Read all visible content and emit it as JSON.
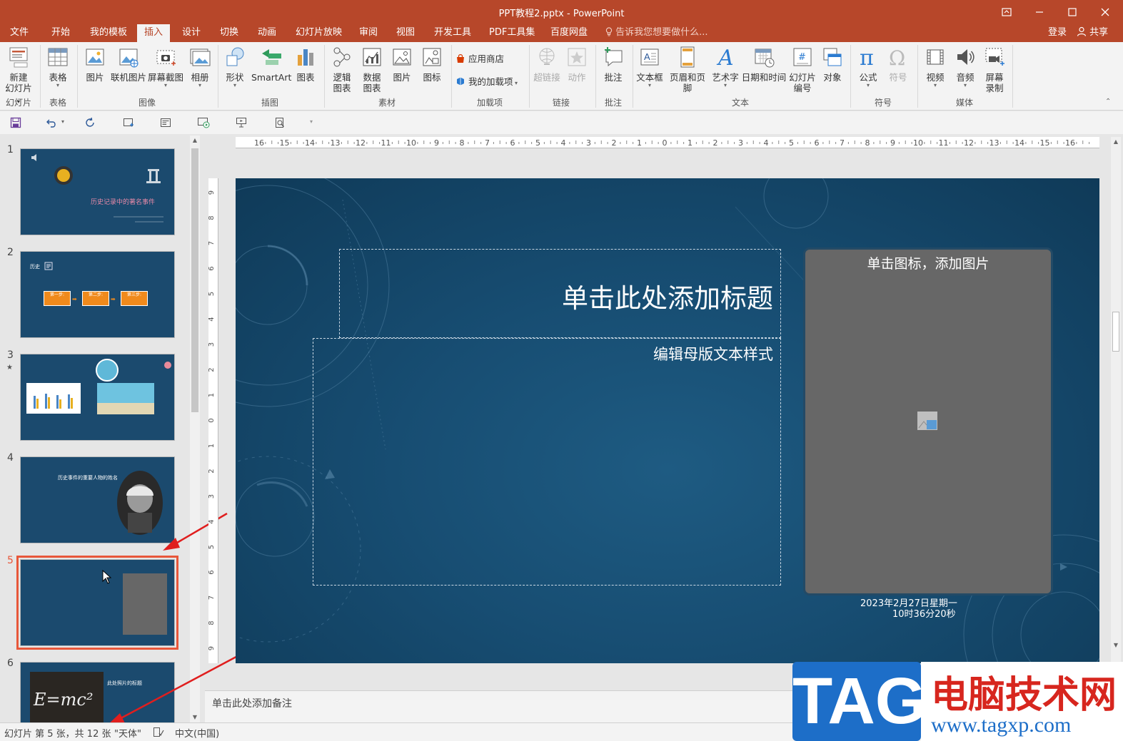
{
  "window": {
    "title": "PPT教程2.pptx - PowerPoint",
    "controls": [
      "restore-ribbon",
      "minimize",
      "maximize",
      "close"
    ]
  },
  "tabs": [
    {
      "label": "文件",
      "active": false
    },
    {
      "label": "开始",
      "active": false
    },
    {
      "label": "我的模板",
      "active": false
    },
    {
      "label": "插入",
      "active": true
    },
    {
      "label": "设计",
      "active": false
    },
    {
      "label": "切换",
      "active": false
    },
    {
      "label": "动画",
      "active": false
    },
    {
      "label": "幻灯片放映",
      "active": false
    },
    {
      "label": "审阅",
      "active": false
    },
    {
      "label": "视图",
      "active": false
    },
    {
      "label": "开发工具",
      "active": false
    },
    {
      "label": "PDF工具集",
      "active": false
    },
    {
      "label": "百度网盘",
      "active": false
    }
  ],
  "tell_me": "告诉我您想要做什么...",
  "account": {
    "login": "登录",
    "share": "共享"
  },
  "ribbon": {
    "groups": [
      {
        "label": "幻灯片"
      },
      {
        "label": "表格"
      },
      {
        "label": "图像"
      },
      {
        "label": "插图"
      },
      {
        "label": "素材"
      },
      {
        "label": "加载项"
      },
      {
        "label": "链接"
      },
      {
        "label": "批注"
      },
      {
        "label": "文本"
      },
      {
        "label": "符号"
      },
      {
        "label": "媒体"
      }
    ],
    "buttons": {
      "new_slide": {
        "line1": "新建",
        "line2": "幻灯片"
      },
      "table": "表格",
      "picture": "图片",
      "online_picture": "联机图片",
      "screenshot": "屏幕截图",
      "album": "相册",
      "shapes": "形状",
      "smartart": "SmartArt",
      "chart": "图表",
      "logic_chart": {
        "line1": "逻辑",
        "line2": "图表"
      },
      "data_chart": {
        "line1": "数据",
        "line2": "图表"
      },
      "material_picture": "图片",
      "icon": "图标",
      "store": "应用商店",
      "my_addins": "我的加载项",
      "hyperlink": "超链接",
      "action": "动作",
      "comment": "批注",
      "textbox": "文本框",
      "header_footer": "页眉和页脚",
      "wordart": "艺术字",
      "datetime": "日期和时间",
      "slide_number": {
        "line1": "幻灯片",
        "line2": "编号"
      },
      "object": "对象",
      "equation": "公式",
      "symbol": "符号",
      "video": "视频",
      "audio": "音频",
      "screen_record": {
        "line1": "屏幕",
        "line2": "录制"
      }
    }
  },
  "ruler": {
    "h_labels": [
      "16",
      "15",
      "14",
      "13",
      "12",
      "11",
      "10",
      "9",
      "8",
      "7",
      "6",
      "5",
      "4",
      "3",
      "2",
      "1",
      "0",
      "1",
      "2",
      "3",
      "4",
      "5",
      "6",
      "7",
      "8",
      "9",
      "10",
      "11",
      "12",
      "13",
      "14",
      "15",
      "16"
    ],
    "v_labels": [
      "9",
      "8",
      "7",
      "6",
      "5",
      "4",
      "3",
      "2",
      "1",
      "0",
      "1",
      "2",
      "3",
      "4",
      "5",
      "6",
      "7",
      "8",
      "9"
    ]
  },
  "thumbnails": [
    {
      "num": "1",
      "title": "历史记录中的著名事件",
      "selected": false,
      "star": false
    },
    {
      "num": "2",
      "title": "历史",
      "steps": [
        "第一步:",
        "第二步:",
        "第三步:"
      ],
      "selected": false,
      "star": false
    },
    {
      "num": "3",
      "selected": false,
      "star": true
    },
    {
      "num": "4",
      "title": "历史事件的重要人物的姓名",
      "selected": false,
      "star": false
    },
    {
      "num": "5",
      "selected": true,
      "star": false
    },
    {
      "num": "6",
      "title": "此处照片的标题",
      "formula": "E=mc²",
      "selected": false,
      "star": false
    }
  ],
  "slide": {
    "title_placeholder": "单击此处添加标题",
    "text_placeholder": "编辑母版文本样式",
    "picture_placeholder": "单击图标，添加图片",
    "date_line1": "2023年2月27日星期一",
    "date_line2": "10时36分20秒"
  },
  "notes_placeholder": "单击此处添加备注",
  "status": {
    "slide_info": "幻灯片 第 5 张，共 12 张",
    "theme": "\"天体\"",
    "language": "中文(中国)"
  },
  "watermark": {
    "tag": "TAG",
    "cn": "电脑技术网",
    "url": "www.tagxp.com"
  },
  "colors": {
    "accent": "#b7472a",
    "slide_bg": "#174d72",
    "selection": "#e8573a"
  }
}
